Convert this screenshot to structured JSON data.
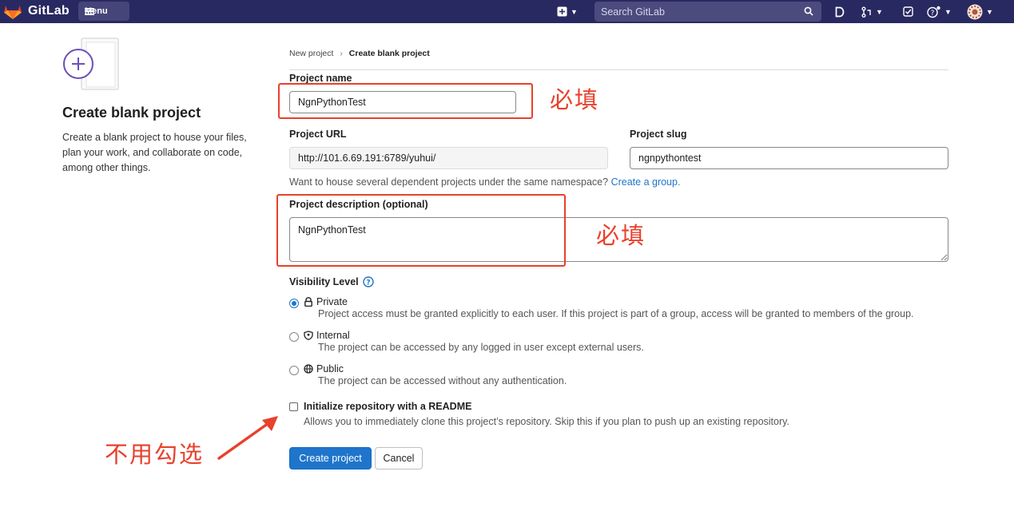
{
  "topbar": {
    "brand": "GitLab",
    "menu_label": "Menu",
    "search_placeholder": "Search GitLab"
  },
  "left": {
    "title": "Create blank project",
    "description": "Create a blank project to house your files, plan your work, and collaborate on code, among other things."
  },
  "breadcrumb": {
    "items": [
      "New project",
      "Create blank project"
    ],
    "separator": "›"
  },
  "form": {
    "project_name_label": "Project name",
    "project_name_value": "NgnPythonTest",
    "project_url_label": "Project URL",
    "project_url_value": "http://101.6.69.191:6789/yuhui/",
    "project_slug_label": "Project slug",
    "project_slug_value": "ngnpythontest",
    "namespace_help": "Want to house several dependent projects under the same namespace?",
    "namespace_link": "Create a group.",
    "description_label": "Project description (optional)",
    "description_value": "NgnPythonTest",
    "visibility_label": "Visibility Level",
    "visibility_options": [
      {
        "title": "Private",
        "desc": "Project access must be granted explicitly to each user. If this project is part of a group, access will be granted to members of the group.",
        "icon": "lock-icon",
        "selected": true
      },
      {
        "title": "Internal",
        "desc": "The project can be accessed by any logged in user except external users.",
        "icon": "shield-icon",
        "selected": false
      },
      {
        "title": "Public",
        "desc": "The project can be accessed without any authentication.",
        "icon": "globe-icon",
        "selected": false
      }
    ],
    "readme_label": "Initialize repository with a README",
    "readme_desc": "Allows you to immediately clone this project’s repository. Skip this if you plan to push up an existing repository.",
    "readme_checked": false,
    "create_button": "Create project",
    "cancel_button": "Cancel"
  },
  "annotations": {
    "required_1": "必填",
    "required_2": "必填",
    "no_check": "不用勾选"
  },
  "colors": {
    "nav_bg": "#292961",
    "primary": "#1f75cb",
    "annotation": "#e8412c"
  }
}
